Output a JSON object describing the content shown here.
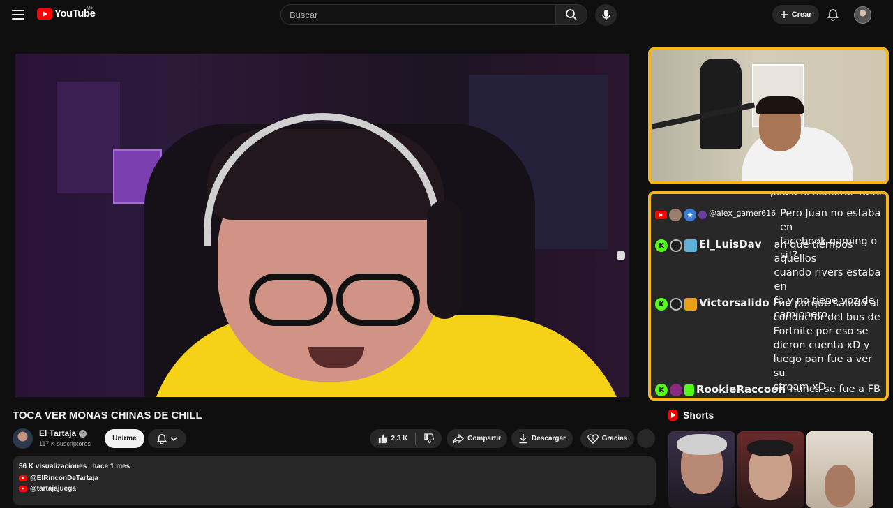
{
  "header": {
    "logo_text": "YouTube",
    "country": "MX",
    "search_placeholder": "Buscar",
    "create_label": "Crear"
  },
  "video": {
    "title": "TOCA VER MONAS CHINAS DE CHILL"
  },
  "channel": {
    "name": "El Tartaja",
    "subscribers": "117 K suscriptores",
    "join_label": "Unirme"
  },
  "actions": {
    "likes": "2,3 K",
    "share_label": "Compartir",
    "download_label": "Descargar",
    "thanks_label": "Gracias"
  },
  "description": {
    "views": "56 K visualizaciones",
    "date": "hace 1 mes",
    "links": [
      "@ElRinconDeTartaja",
      "@tartajajuega"
    ]
  },
  "chat": {
    "overflow_text": "podía ni nombrar Twitch",
    "messages": [
      {
        "platform": "youtube",
        "user": "@alex_gamer616",
        "text_lines": [
          "Pero Juan no estaba en",
          "facebook gaming o si!?"
        ]
      },
      {
        "platform": "kick",
        "user": "El_LuisDav",
        "text_lines": [
          "ah que tiempos aquellos",
          "cuando rivers estaba en",
          "fb y no tiene voz de",
          "camionero"
        ]
      },
      {
        "platform": "kick",
        "user": "Victorsalido",
        "text_lines": [
          "Fue porque saludo al",
          "conductor del bus de",
          "Fortnite por eso se",
          "dieron cuenta xD y",
          "luego pan fue a ver su",
          "stream xD"
        ]
      },
      {
        "platform": "kick",
        "user": "RookieRaccoon",
        "text_lines": [
          "nunca se fue a FB"
        ]
      }
    ]
  },
  "shorts": {
    "heading": "Shorts"
  },
  "colors": {
    "accent": "#ff0000",
    "overlay_border": "#f5b51b",
    "kick_green": "#53fc18",
    "background": "#0f0f0f"
  }
}
